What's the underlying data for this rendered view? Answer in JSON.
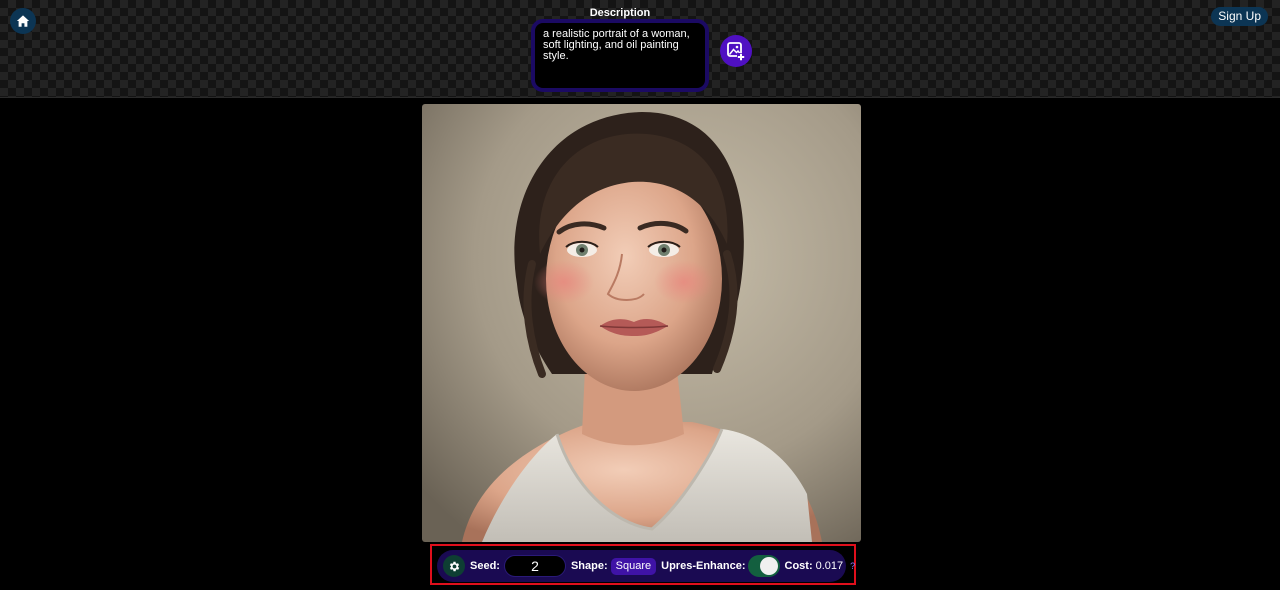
{
  "header": {
    "home_icon": "home-icon",
    "signup_label": "Sign Up",
    "description_label": "Description",
    "description_text": "a realistic portrait of a woman, soft lighting, and oil painting style.",
    "add_image_icon": "image-plus-icon"
  },
  "controls": {
    "settings_icon": "gear-icon",
    "seed_label": "Seed:",
    "seed_value": "2",
    "shape_label": "Shape:",
    "shape_value": "Square",
    "upres_label": "Upres-Enhance:",
    "upres_enabled": true,
    "cost_label": "Cost:",
    "cost_value": "0.017",
    "help_label": "?"
  },
  "colors": {
    "accent_purple": "#4f10c2",
    "controls_bg": "#1a0a52",
    "toggle_on": "#135f3f",
    "highlight_outline": "#e00f1c"
  }
}
